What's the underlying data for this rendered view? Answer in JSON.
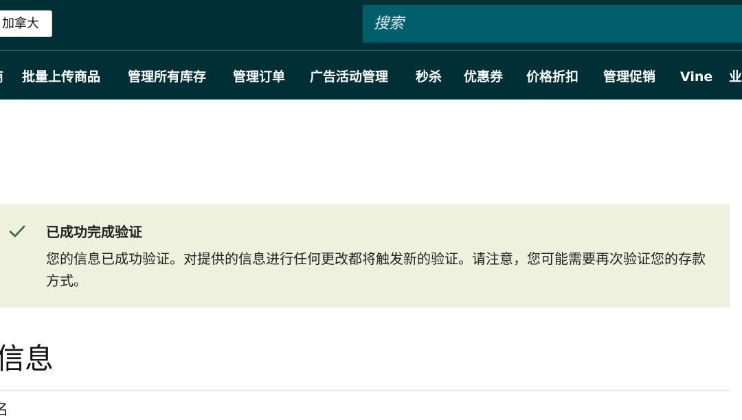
{
  "header": {
    "marketplace_label": "加拿大",
    "search_placeholder": "搜索",
    "nav_items": [
      {
        "label": "商"
      },
      {
        "label": "批量上传商品"
      },
      {
        "label": "管理所有库存"
      },
      {
        "label": "管理订单"
      },
      {
        "label": "广告活动管理"
      },
      {
        "label": "秒杀"
      },
      {
        "label": "优惠券"
      },
      {
        "label": "价格折扣"
      },
      {
        "label": "管理促销"
      },
      {
        "label": "Vine"
      },
      {
        "label": "业"
      }
    ]
  },
  "alert": {
    "title": "已成功完成验证",
    "body": "您的信息已成功验证。对提供的信息进行任何更改都将触发新的验证。请注意，您可能需要再次验证您的存款方式。",
    "icon": "check-icon",
    "check_color": "#2e6b2e"
  },
  "section": {
    "title": "信息",
    "sub_label": "名"
  },
  "colors": {
    "header_bg": "#002f36",
    "search_bg": "#005f6b",
    "alert_bg": "#eff1df"
  }
}
